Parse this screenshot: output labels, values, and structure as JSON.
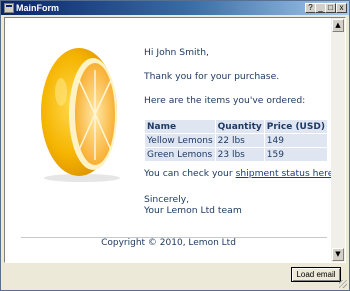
{
  "window": {
    "title": "MainForm",
    "controls": {
      "help": "?",
      "minimize": "_",
      "maximize": "□",
      "close": "x"
    }
  },
  "email": {
    "greeting": "Hi John Smith,",
    "thanks": "Thank you for your purchase.",
    "items_intro": "Here are the items you've ordered:",
    "table": {
      "headers": [
        "Name",
        "Quantity",
        "Price (USD)"
      ],
      "rows": [
        [
          "Yellow Lemons",
          "22 lbs",
          "149"
        ],
        [
          "Green Lemons",
          "23 lbs",
          "159"
        ]
      ]
    },
    "status_text_before": "You can check your ",
    "status_link": "shipment status here",
    "status_text_after": ".",
    "closing": "Sincerely,",
    "signature": "Your Lemon Ltd team",
    "footer": "Copyright © 2010, Lemon Ltd"
  },
  "buttons": {
    "load_email": "Load email"
  },
  "icons": {
    "app": "window-app-icon",
    "scroll_up": "scroll-up-arrow-icon",
    "scroll_down": "scroll-down-arrow-icon"
  },
  "colors": {
    "title_gradient_start": "#0a246a",
    "text": "#1f3b63",
    "link": "#1a3a8a",
    "table_bg": "#dfe6f2"
  }
}
